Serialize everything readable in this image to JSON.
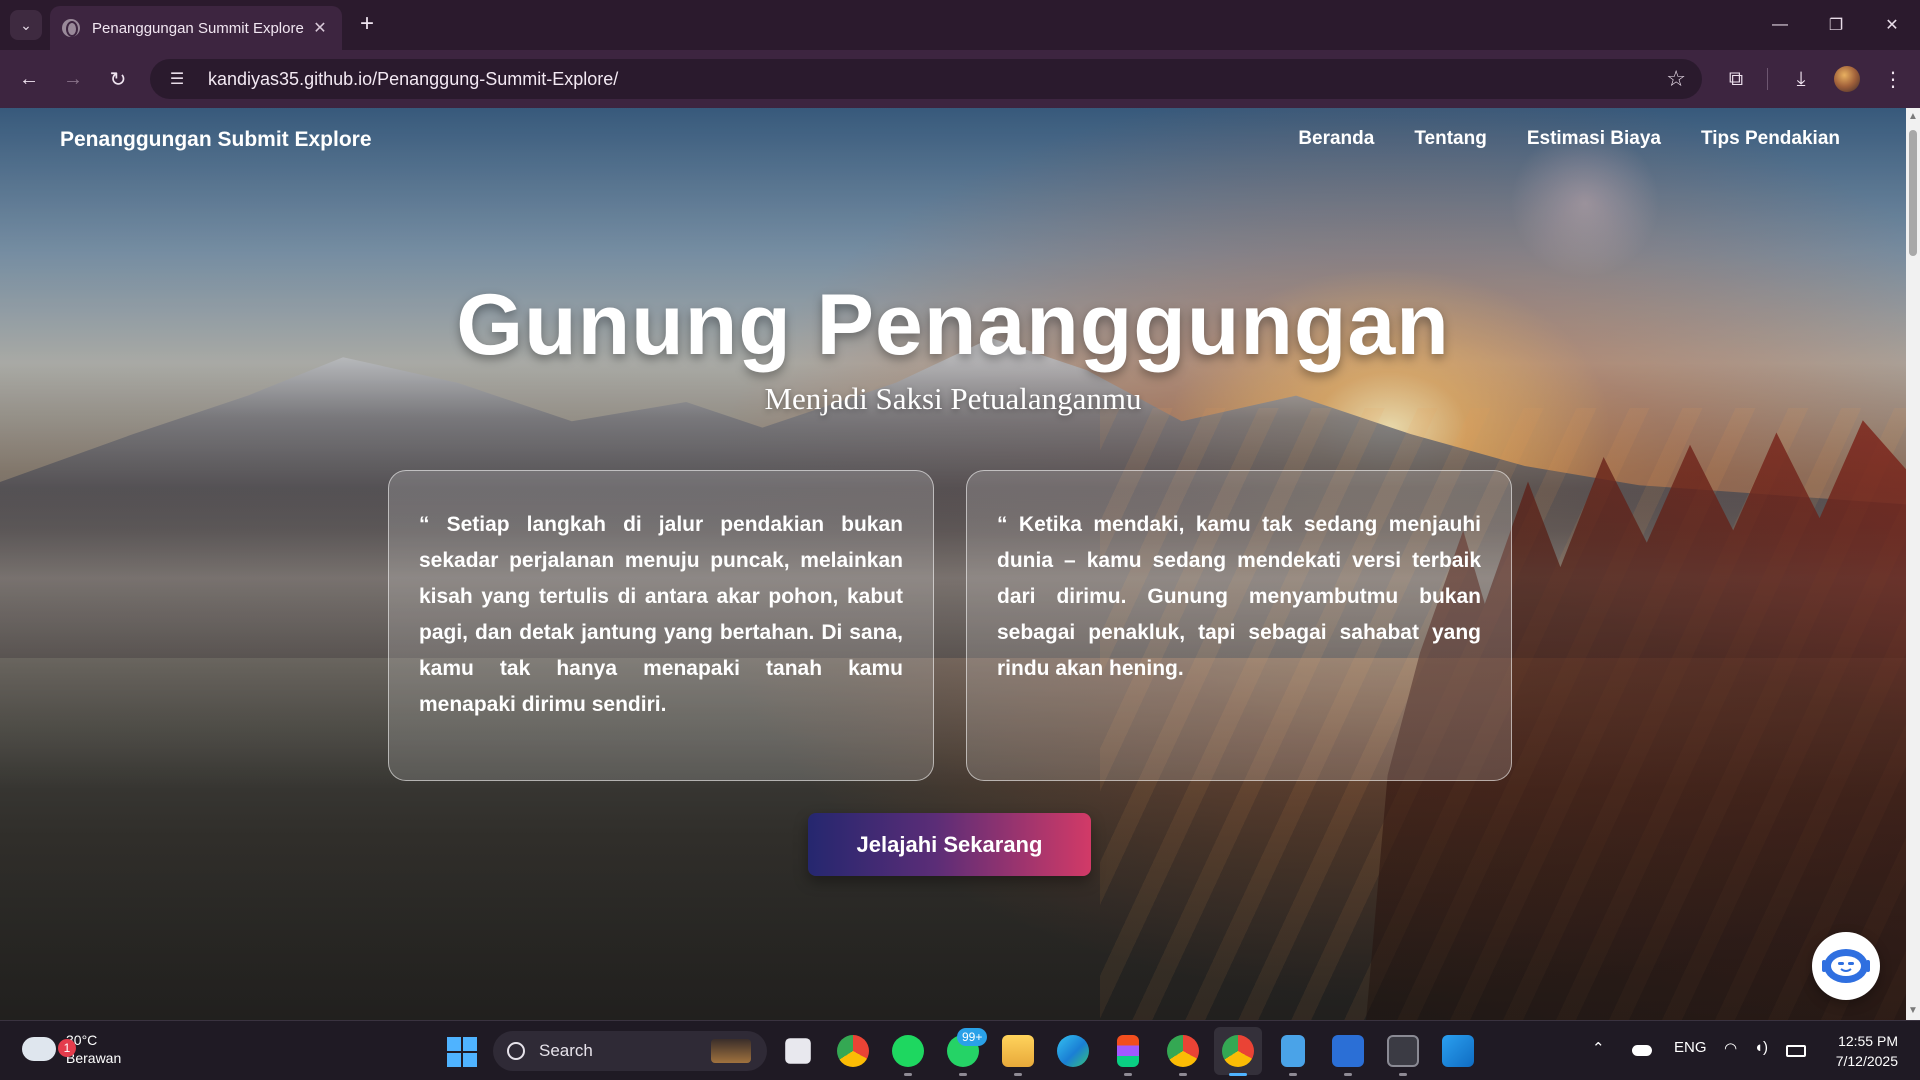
{
  "browser": {
    "tab_title": "Penanggungan Summit Explore",
    "url": "kandiyas35.github.io/Penanggung-Summit-Explore/"
  },
  "site": {
    "brand": "Penanggungan Submit Explore",
    "menu": [
      "Beranda",
      "Tentang",
      "Estimasi Biaya",
      "Tips Pendakian"
    ],
    "hero_title": "Gunung Penanggungan",
    "hero_subtitle": "Menjadi Saksi Petualanganmu",
    "quotes": [
      "“ Setiap langkah di jalur pendakian bukan sekadar perjalanan menuju puncak, melainkan kisah yang tertulis di antara akar pohon, kabut pagi, dan detak jantung yang bertahan. Di sana, kamu tak hanya menapaki tanah kamu menapaki dirimu sendiri.",
      "“ Ketika mendaki, kamu tak sedang menjauhi dunia – kamu sedang mendekati versi terbaik dari dirimu. Gunung menyambutmu bukan sebagai penakluk, tapi sebagai sahabat yang rindu akan hening."
    ],
    "cta_label": "Jelajahi Sekarang"
  },
  "taskbar": {
    "weather_temp": "30°C",
    "weather_desc": "Berawan",
    "weather_badge": "1",
    "search_placeholder": "Search",
    "whatsapp_badge": "99+",
    "language": "ENG",
    "time": "12:55 PM",
    "date": "7/12/2025",
    "apps": [
      "task-view",
      "chrome",
      "spotify",
      "whatsapp",
      "file-explorer",
      "edge",
      "figma",
      "chrome-profile",
      "chrome-active",
      "notepad",
      "vs-app",
      "terminal",
      "vscode"
    ]
  },
  "colors": {
    "cta_start": "#25276f",
    "cta_end": "#d23a67",
    "chrome_bg": "#3d2540"
  }
}
